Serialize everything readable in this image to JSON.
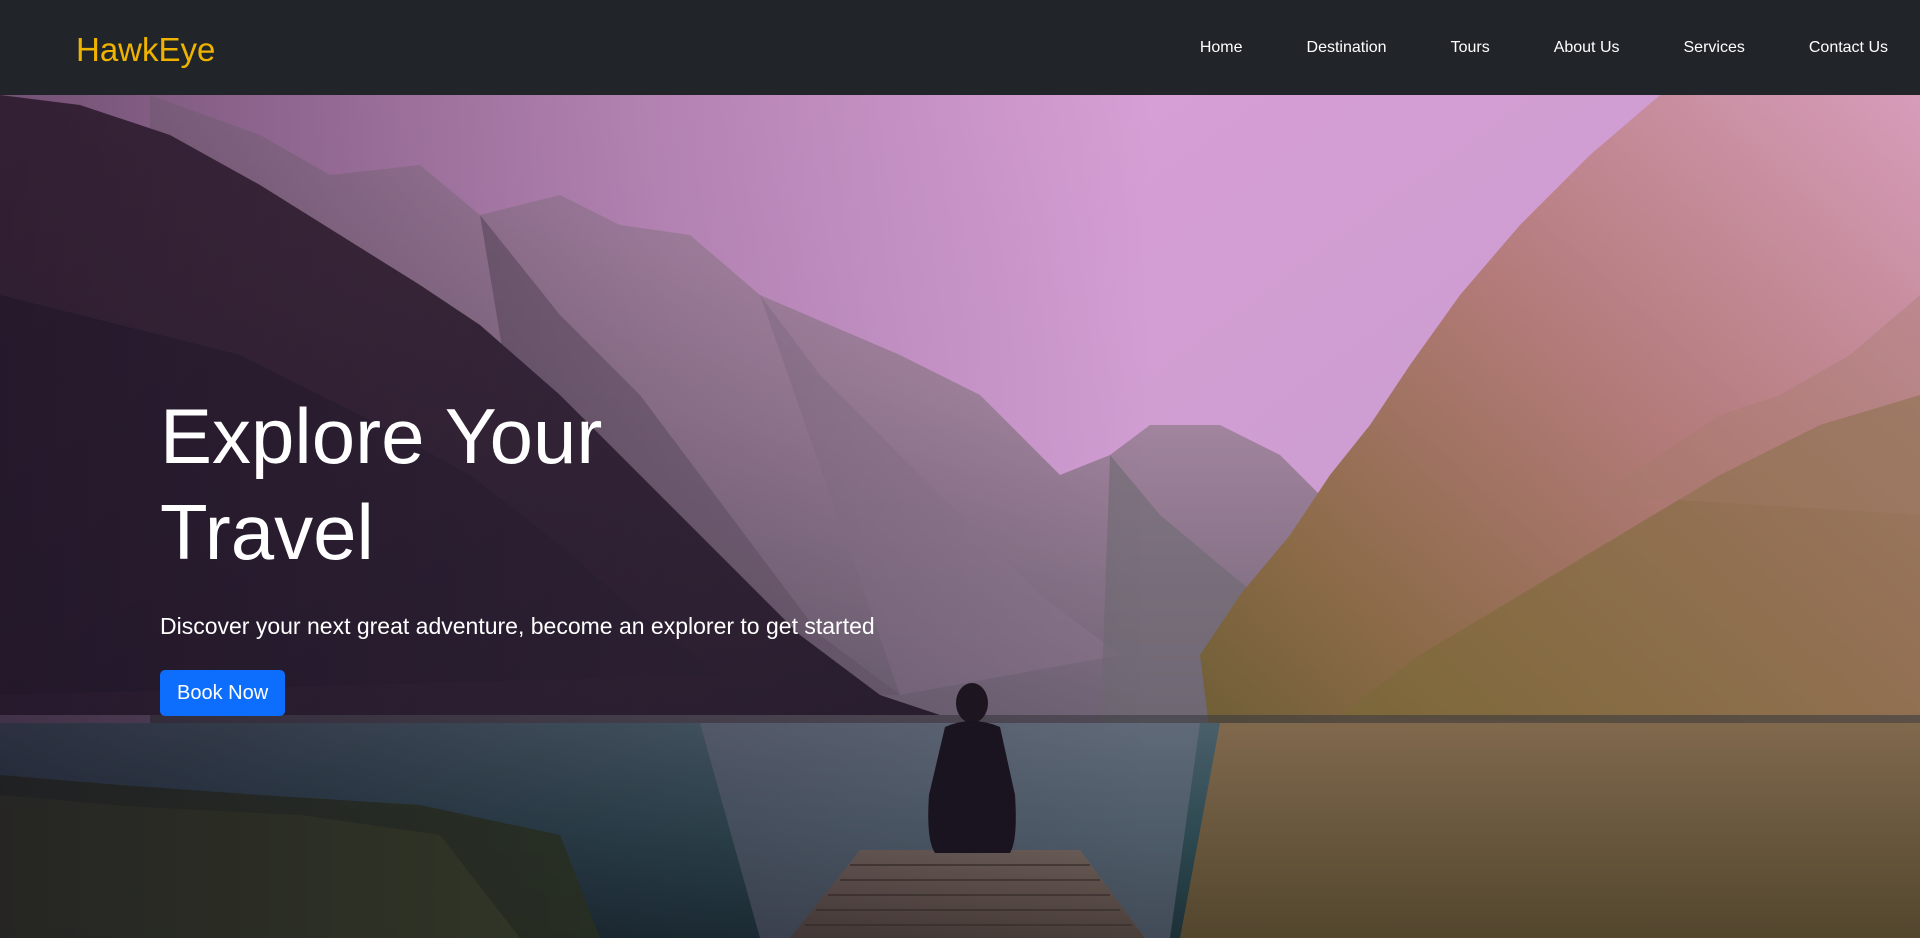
{
  "brand": {
    "name": "HawkEye",
    "color": "#f0b400"
  },
  "nav": {
    "items": [
      {
        "label": "Home"
      },
      {
        "label": "Destination"
      },
      {
        "label": "Tours"
      },
      {
        "label": "About Us"
      },
      {
        "label": "Services"
      },
      {
        "label": "Contact Us"
      }
    ]
  },
  "hero": {
    "title": "Explore Your Travel",
    "subtitle": "Discover your next great adventure, become an explorer to get started",
    "button_label": "Book Now",
    "button_color": "#0d6efd",
    "background": "mountain-lake-landscape-image"
  },
  "colors": {
    "navbar_bg": "#212529",
    "sky_top": "#e3a2dc",
    "sky_bottom": "#c89ccb"
  }
}
